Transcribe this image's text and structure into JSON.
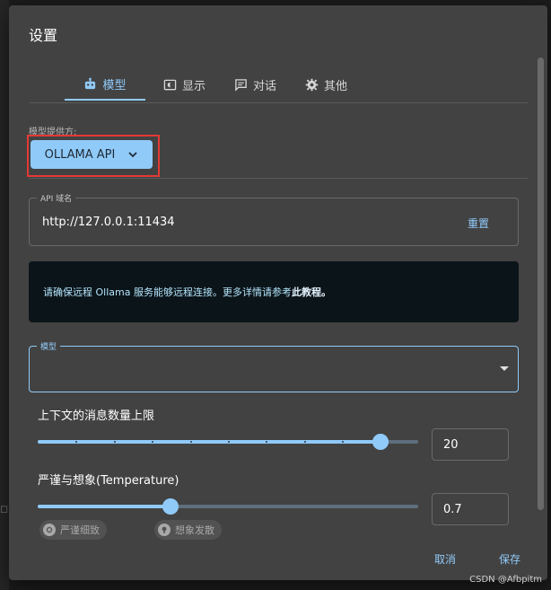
{
  "dialog": {
    "title": "设置"
  },
  "tabs": [
    {
      "label": "模型",
      "icon": "robot-icon",
      "active": true
    },
    {
      "label": "显示",
      "icon": "display-icon",
      "active": false
    },
    {
      "label": "对话",
      "icon": "chat-icon",
      "active": false
    },
    {
      "label": "其他",
      "icon": "gear-icon",
      "active": false
    }
  ],
  "provider": {
    "label": "模型提供方:",
    "selected": "OLLAMA API"
  },
  "api": {
    "legend": "API 域名",
    "value": "http://127.0.0.1:11434",
    "reset_label": "重置"
  },
  "info": {
    "text": "请确保远程 Ollama 服务能够远程连接。更多详情请参考",
    "link": "此教程。"
  },
  "model": {
    "legend": "模型",
    "value": ""
  },
  "context_limit": {
    "title": "上下文的消息数量上限",
    "value": "20",
    "fraction": 0.9
  },
  "temperature": {
    "title": "严谨与想象(Temperature)",
    "value": "0.7",
    "fraction": 0.35,
    "chip_strict": "严谨细致",
    "chip_imaginative": "想象发散"
  },
  "footer": {
    "cancel_label": "取消",
    "save_label": "保存"
  },
  "watermark": "CSDN @Afbpitm",
  "colors": {
    "accent": "#90caf9",
    "dialog_bg": "#424242",
    "highlight": "#e53935"
  }
}
